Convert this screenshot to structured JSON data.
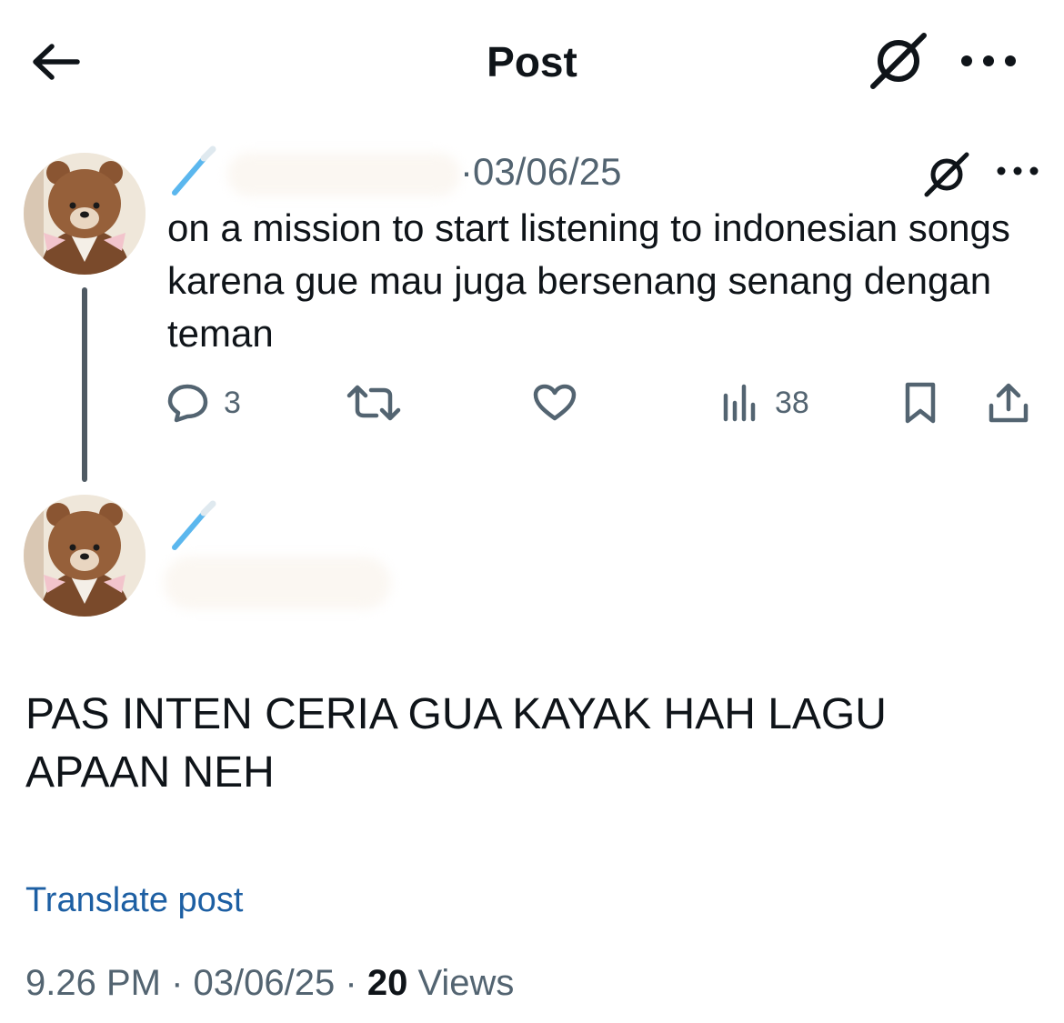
{
  "header": {
    "title": "Post",
    "back_icon": "arrow-left-icon",
    "grok_icon": "grok-icon",
    "more_icon": "more-horizontal-icon"
  },
  "quoted_post": {
    "name_emoji": "toothbrush-emoji",
    "date": "·03/06/25",
    "text": "on a mission to start listening to indonesian songs karena gue mau juga bersenang senang dengan teman",
    "replies": "3",
    "views": "38"
  },
  "main_post": {
    "name_emoji": "toothbrush-emoji",
    "text": "PAS INTEN CERIA GUA KAYAK HAH LAGU APAAN NEH",
    "translate_label": "Translate post",
    "time": "9.26 PM",
    "date": "03/06/25",
    "views_count": "20",
    "views_label": "Views",
    "separator": "·"
  },
  "colors": {
    "text_primary": "#0f1419",
    "text_secondary": "#536471",
    "link": "#1d5fa3",
    "thread_line": "#4f5a63"
  }
}
